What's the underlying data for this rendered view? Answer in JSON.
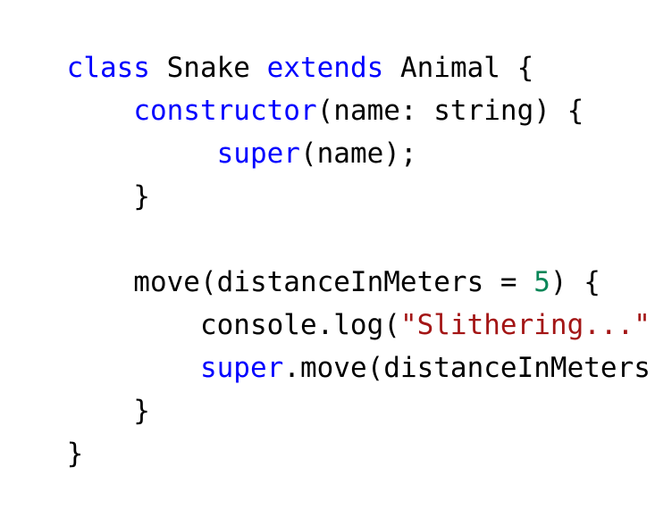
{
  "editor": {
    "lines": [
      {
        "segments": [
          {
            "text": "class",
            "kind": "keyword"
          },
          {
            "text": " Snake ",
            "kind": "plain"
          },
          {
            "text": "extends",
            "kind": "keyword"
          },
          {
            "text": " Animal {",
            "kind": "plain"
          }
        ]
      },
      {
        "segments": [
          {
            "text": "    ",
            "kind": "plain"
          },
          {
            "text": "constructor",
            "kind": "keyword"
          },
          {
            "text": "(name: string) {",
            "kind": "plain"
          }
        ]
      },
      {
        "segments": [
          {
            "text": "         ",
            "kind": "plain"
          },
          {
            "text": "super",
            "kind": "keyword"
          },
          {
            "text": "(name);",
            "kind": "plain"
          }
        ]
      },
      {
        "segments": [
          {
            "text": "    }",
            "kind": "plain"
          }
        ]
      },
      {
        "segments": []
      },
      {
        "segments": [
          {
            "text": "    move(distanceInMeters = ",
            "kind": "plain"
          },
          {
            "text": "5",
            "kind": "number"
          },
          {
            "text": ") {",
            "kind": "plain"
          }
        ]
      },
      {
        "segments": [
          {
            "text": "        console.log(",
            "kind": "plain"
          },
          {
            "text": "\"Slithering...\"",
            "kind": "string"
          },
          {
            "text": ");",
            "kind": "plain"
          }
        ]
      },
      {
        "segments": [
          {
            "text": "        ",
            "kind": "plain"
          },
          {
            "text": "super",
            "kind": "keyword"
          },
          {
            "text": ".move(distanceInMeters);",
            "kind": "plain"
          }
        ]
      },
      {
        "segments": [
          {
            "text": "    }",
            "kind": "plain"
          }
        ]
      },
      {
        "segments": [
          {
            "text": "}",
            "kind": "plain"
          }
        ]
      }
    ]
  },
  "colors": {
    "keyword": "#0000ff",
    "string": "#a31515",
    "number": "#098658",
    "plain": "#000000",
    "background": "#ffffff"
  }
}
